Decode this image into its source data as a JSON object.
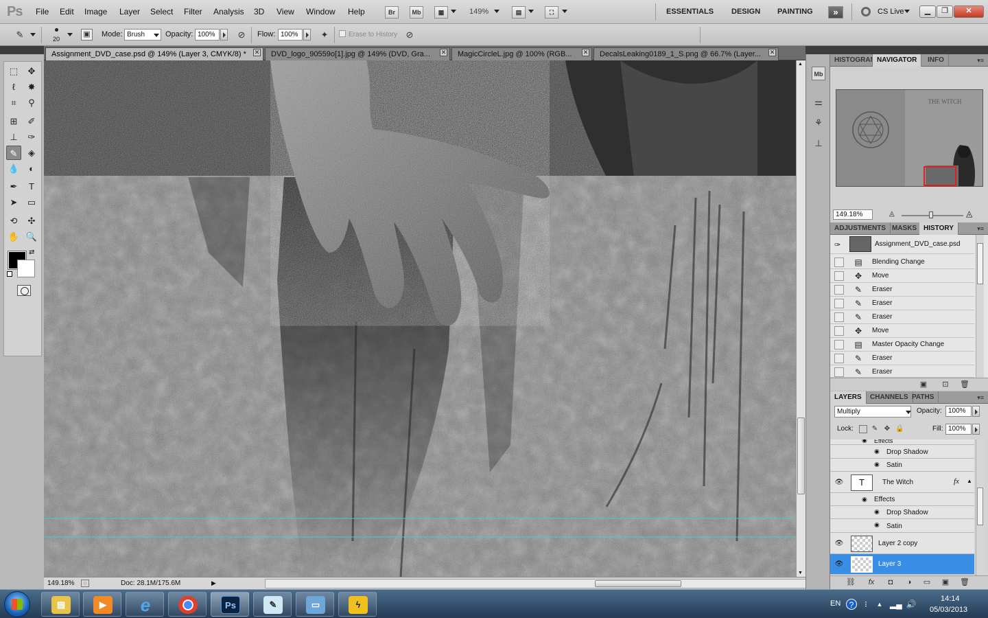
{
  "menubar": {
    "logo": "Ps",
    "items": [
      "File",
      "Edit",
      "Image",
      "Layer",
      "Select",
      "Filter",
      "Analysis",
      "3D",
      "View",
      "Window",
      "Help"
    ],
    "bridge_label": "Br",
    "minibridge_label": "Mb",
    "zoom_value": "149%",
    "workspaces": [
      "ESSENTIALS",
      "DESIGN",
      "PAINTING"
    ],
    "more_label": "»",
    "cs_live": "CS Live"
  },
  "options": {
    "brush_size": "20",
    "mode_label": "Mode:",
    "mode_value": "Brush",
    "opacity_label": "Opacity:",
    "opacity_value": "100%",
    "flow_label": "Flow:",
    "flow_value": "100%",
    "erase_history_label": "Erase to History"
  },
  "tabs": [
    {
      "label": "Assignment_DVD_case.psd @ 149% (Layer 3, CMYK/8) *"
    },
    {
      "label": "DVD_logo_90559o[1].jpg @ 149% (DVD, Gra..."
    },
    {
      "label": "MagicCircleL.jpg @ 100% (RGB..."
    },
    {
      "label": "DecalsLeaking0189_1_S.png @ 66.7% (Layer..."
    }
  ],
  "status": {
    "zoom": "149.18%",
    "doc_info": "Doc: 28.1M/175.6M"
  },
  "navigator": {
    "tabs": [
      "HISTOGRAM",
      "NAVIGATOR",
      "INFO"
    ],
    "zoom": "149.18%",
    "thumb_title": "THE WITCH"
  },
  "history": {
    "tabs": [
      "ADJUSTMENTS",
      "MASKS",
      "HISTORY"
    ],
    "snapshot": "Assignment_DVD_case.psd",
    "items": [
      {
        "label": "Blending Change",
        "icon": "layer-icon"
      },
      {
        "label": "Move",
        "icon": "move-icon"
      },
      {
        "label": "Eraser",
        "icon": "eraser-icon"
      },
      {
        "label": "Eraser",
        "icon": "eraser-icon"
      },
      {
        "label": "Eraser",
        "icon": "eraser-icon"
      },
      {
        "label": "Move",
        "icon": "move-icon"
      },
      {
        "label": "Master Opacity Change",
        "icon": "layer-icon"
      },
      {
        "label": "Eraser",
        "icon": "eraser-icon"
      },
      {
        "label": "Eraser",
        "icon": "eraser-icon"
      }
    ]
  },
  "layers": {
    "tabs": [
      "LAYERS",
      "CHANNELS",
      "PATHS"
    ],
    "blend_mode": "Multiply",
    "opacity_label": "Opacity:",
    "opacity_value": "100%",
    "lock_label": "Lock:",
    "fill_label": "Fill:",
    "fill_value": "100%",
    "effects_label": "Effects",
    "drop_shadow": "Drop Shadow",
    "satin": "Satin",
    "text_layer": "The   Witch",
    "fx_label": "fx",
    "layer2copy": "Layer 2 copy",
    "layer3": "Layer 3",
    "selection_color": "#3a8ee6"
  },
  "taskbar": {
    "lang": "EN",
    "time": "14:14",
    "date": "05/03/2013",
    "ps_label": "Ps"
  }
}
